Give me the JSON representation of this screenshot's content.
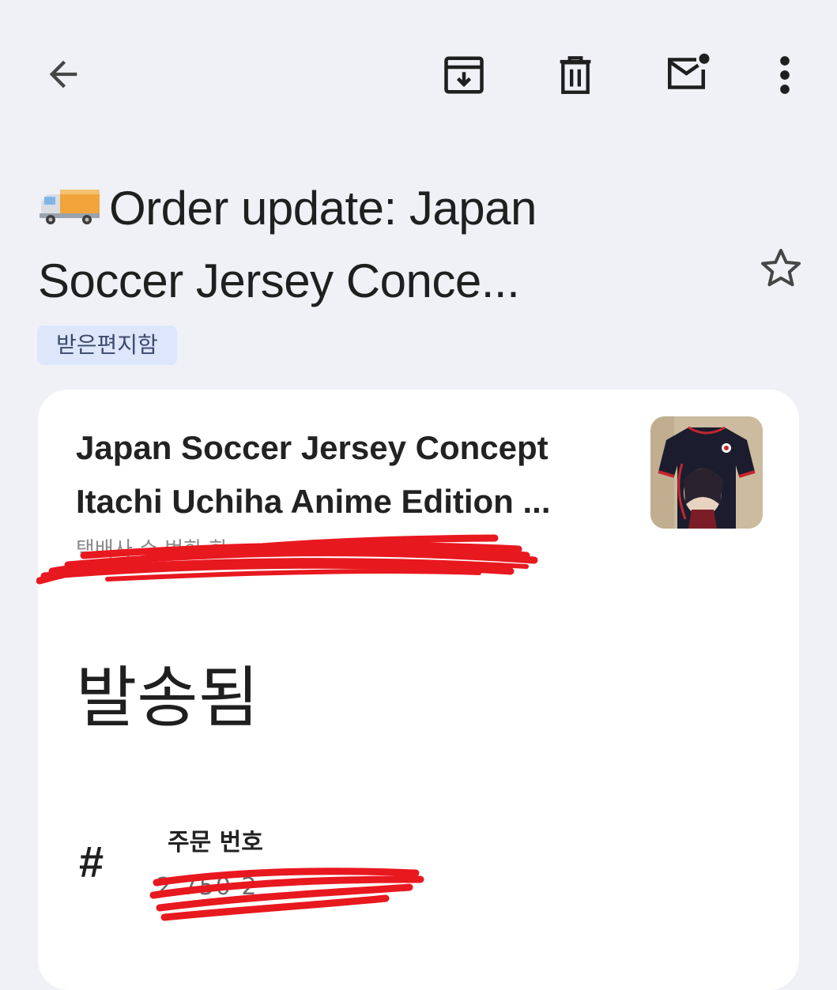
{
  "toolbar": {
    "back_icon": "arrow-left-icon",
    "archive_icon": "archive-icon",
    "delete_icon": "trash-icon",
    "unread_icon": "mark-unread-icon",
    "more_icon": "more-vert-icon"
  },
  "email": {
    "subject_emoji": "delivery-truck-icon",
    "subject_line1": "Order update: Japan",
    "subject_line2": "Soccer Jersey Conce...",
    "star_icon": "star-outline-icon",
    "label": "받은편지함"
  },
  "card": {
    "product_title_line1": "Japan Soccer Jersey Concept",
    "product_title_line2": "Itachi Uchiha Anime Edition ...",
    "redacted_text": "택배사 수 번화 화 ",
    "status": "발송됨",
    "order_icon": "#",
    "order_label": "주문 번호",
    "order_number": "2 750 2"
  },
  "colors": {
    "background": "#eff1f7",
    "card": "#ffffff",
    "chip_bg": "#dde6fb",
    "scribble": "#e8181f"
  }
}
